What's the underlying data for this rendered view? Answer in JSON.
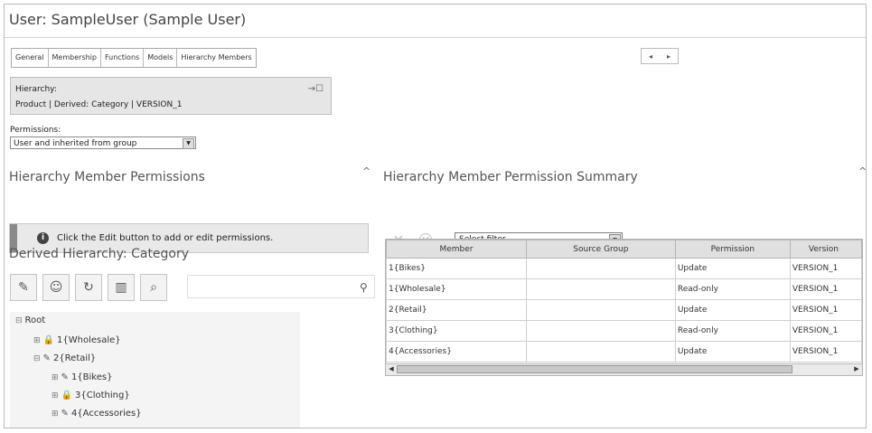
{
  "window": {
    "title": "User: SampleUser (Sample User)"
  },
  "tabs": [
    {
      "label": "General"
    },
    {
      "label": "Membership"
    },
    {
      "label": "Functions"
    },
    {
      "label": "Models"
    },
    {
      "label": "Hierarchy Members"
    }
  ],
  "tab_scroll": {
    "left": "◂",
    "right": "▸"
  },
  "hierarchy": {
    "label": "Hierarchy:",
    "value": "Product | Derived: Category | VERSION_1",
    "icon": "→☐"
  },
  "permissions": {
    "label": "Permissions:",
    "selected": "User and inherited from group"
  },
  "left_panel": {
    "heading": "Hierarchy Member Permissions",
    "info_text": "Click the Edit button to add or edit permissions.",
    "derived_heading": "Derived Hierarchy: Category",
    "toolbar_icons": [
      "edit-icon",
      "user-icon",
      "refresh-icon",
      "columns-icon",
      "search-doc-icon"
    ],
    "tree": [
      {
        "label": "Root",
        "expander": "⊟",
        "icon": ""
      },
      {
        "label": "1{Wholesale}",
        "expander": "⊞",
        "icon": "🔒"
      },
      {
        "label": "2{Retail}",
        "expander": "⊟",
        "icon": "✎"
      },
      {
        "label": "1{Bikes}",
        "expander": "⊞",
        "icon": "✎"
      },
      {
        "label": "3{Clothing}",
        "expander": "⊞",
        "icon": "🔒"
      },
      {
        "label": "4{Accessories}",
        "expander": "⊞",
        "icon": "✎"
      }
    ]
  },
  "right_panel": {
    "heading": "Hierarchy Member Permission Summary",
    "filter": {
      "selected": "Select filter"
    },
    "columns": [
      "Member",
      "Source Group",
      "Permission",
      "Version"
    ],
    "rows": [
      [
        "1{Bikes}",
        "",
        "Update",
        "VERSION_1"
      ],
      [
        "1{Wholesale}",
        "",
        "Read-only",
        "VERSION_1"
      ],
      [
        "2{Retail}",
        "",
        "Update",
        "VERSION_1"
      ],
      [
        "3{Clothing}",
        "",
        "Read-only",
        "VERSION_1"
      ],
      [
        "4{Accessories}",
        "",
        "Update",
        "VERSION_1"
      ]
    ]
  }
}
